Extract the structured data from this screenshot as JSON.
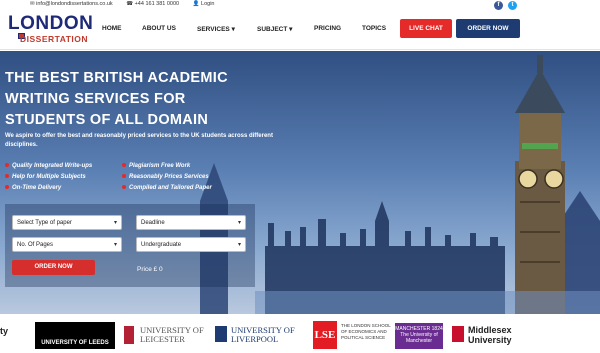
{
  "topbar": {
    "email": "info@londondissertations.co.uk",
    "phone": "+44 161 381 0000",
    "login": "Login",
    "facebook_glyph": "f",
    "twitter_glyph": "t"
  },
  "logo": {
    "line1": "LONDON",
    "line2": "DISSERTATION"
  },
  "nav": {
    "home": "HOME",
    "about": "ABOUT US",
    "services": "SERVICES",
    "subject": "SUBJECT",
    "pricing": "PRICING",
    "topics": "TOPICS",
    "dropdown_glyph": "▾",
    "live_chat": "LIVE CHAT",
    "order_now": "ORDER NOW"
  },
  "hero": {
    "title": "THE BEST BRITISH ACADEMIC WRITING SERVICES FOR STUDENTS OF ALL DOMAIN",
    "subtitle": "We aspire to offer the best and reasonably priced services to the UK students across different disciplines.",
    "features_left": [
      "Quality Integrated Write-ups",
      "Help for Multiple Subjects",
      "On-Time Delivery"
    ],
    "features_right": [
      "Plagiarism Free Work",
      "Reasonably Prices Services",
      "Compiled and Tailored Paper"
    ]
  },
  "order_form": {
    "type_of_paper": "Select Type of paper",
    "deadline": "Deadline",
    "pages": "No. Of Pages",
    "level": "Undergraduate",
    "submit": "ORDER NOW",
    "price": "Price £ 0"
  },
  "universities": [
    "ty",
    "UNIVERSITY OF LEEDS",
    "UNIVERSITY OF LEICESTER",
    "UNIVERSITY OF LIVERPOOL",
    "LSE",
    "THE LONDON SCHOOL OF ECONOMICS AND POLITICAL SCIENCE",
    "MANCHESTER 1824 The University of Manchester",
    "Middlesex University"
  ],
  "colors": {
    "brand_navy": "#1e3c72",
    "brand_red": "#e52a2a",
    "hero_sky": "#4a6fa5"
  }
}
